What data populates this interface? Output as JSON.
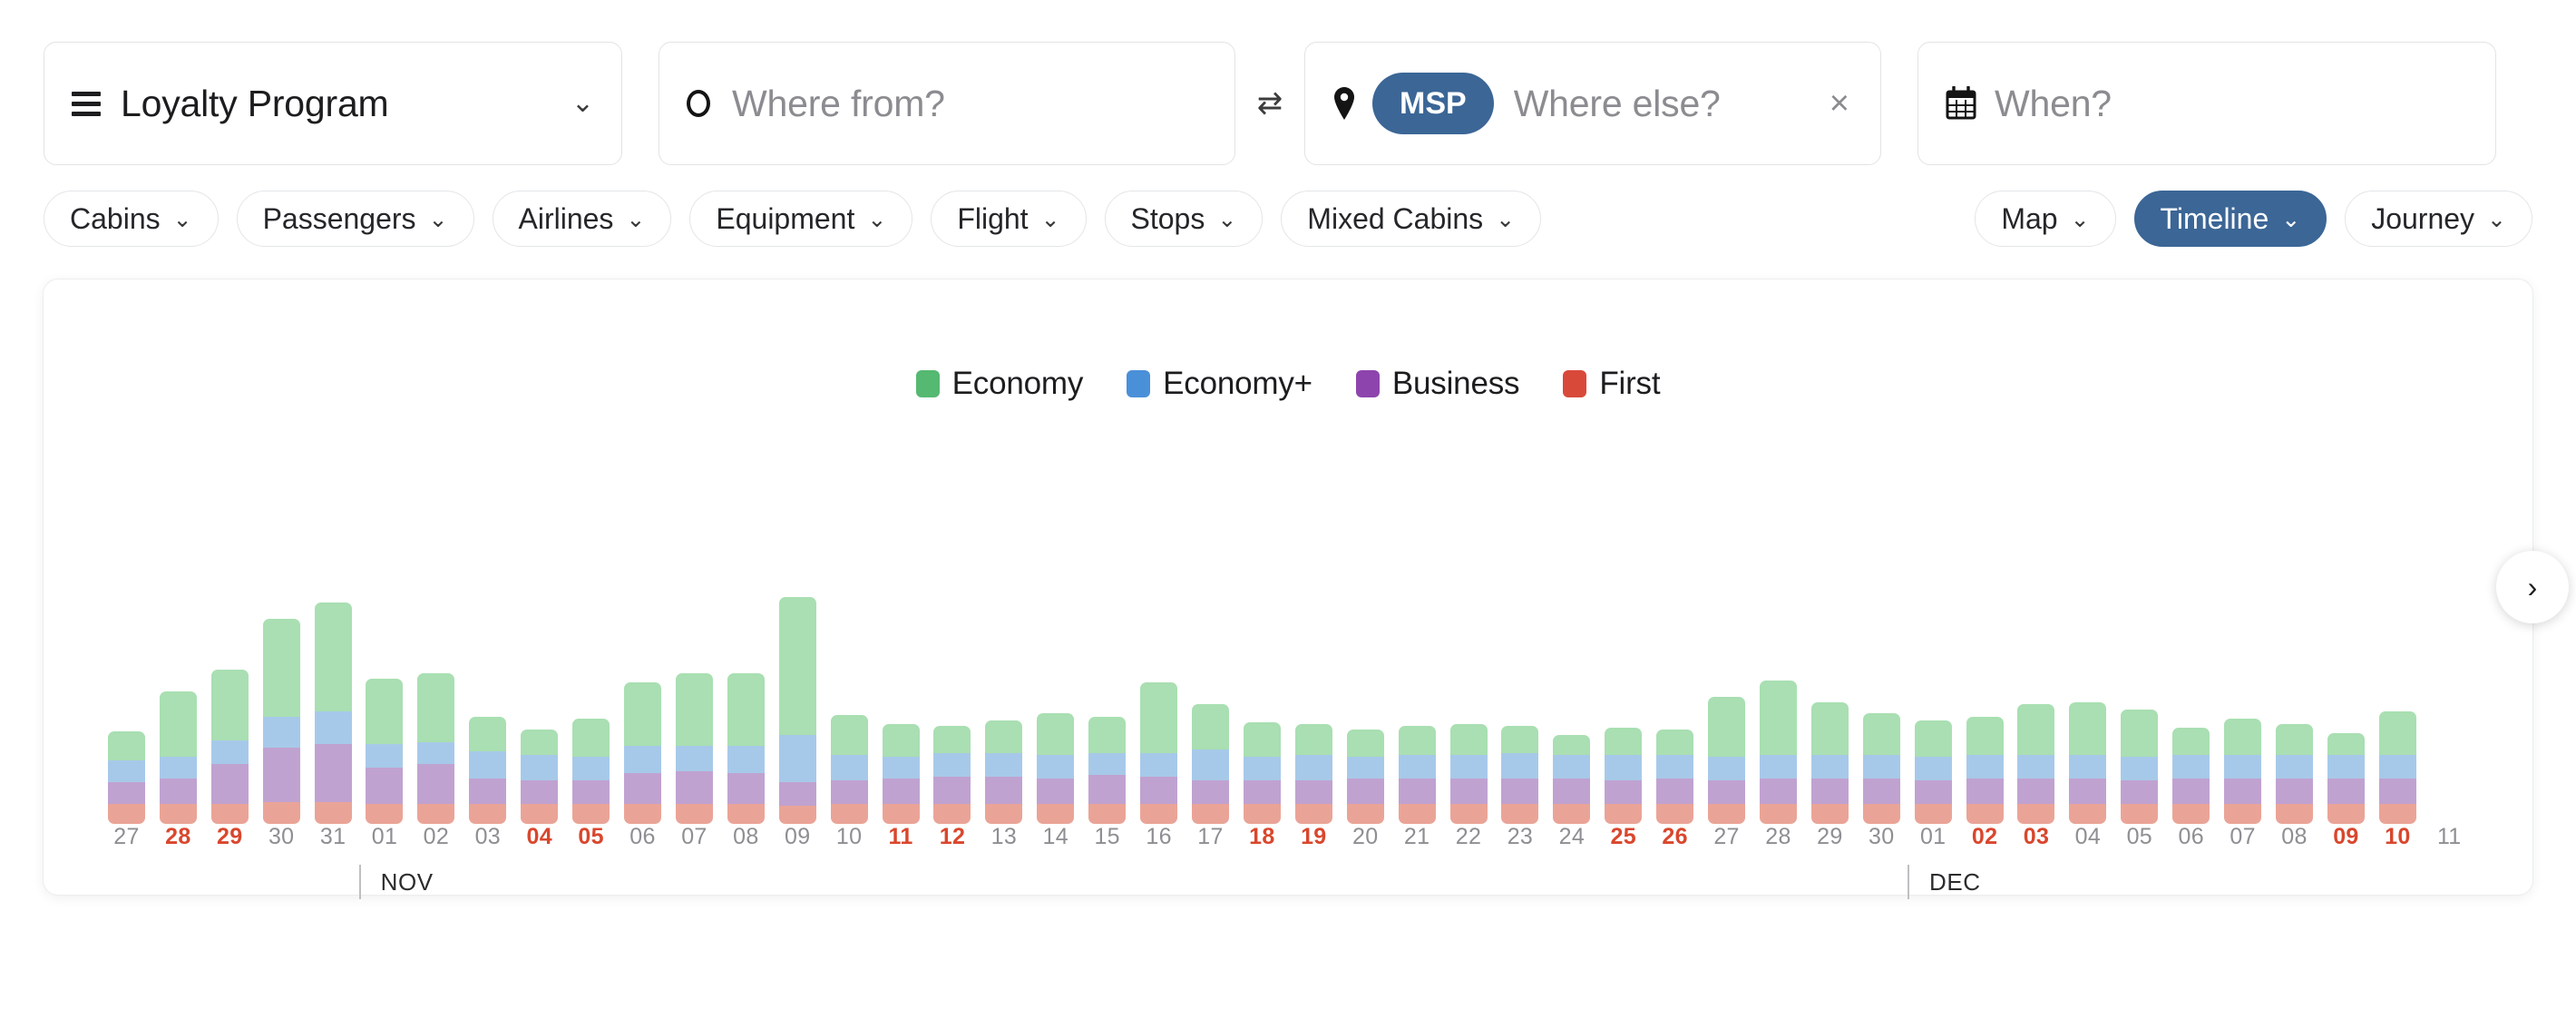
{
  "search": {
    "loyalty": {
      "label": "Loyalty Program",
      "menu_icon": "hamburger-icon",
      "chevron": "⌄"
    },
    "origin": {
      "placeholder": "Where from?",
      "icon": "circle-icon",
      "value": ""
    },
    "swap": {
      "icon": "swap-arrows-icon",
      "glyph": "⇄"
    },
    "destination": {
      "placeholder": "Where else?",
      "chip": "MSP",
      "icon": "map-pin-icon",
      "clear": "×"
    },
    "when": {
      "placeholder": "When?",
      "icon": "calendar-icon"
    }
  },
  "filters": {
    "left": [
      {
        "label": "Cabins",
        "active": false
      },
      {
        "label": "Passengers",
        "active": false
      },
      {
        "label": "Airlines",
        "active": false
      },
      {
        "label": "Equipment",
        "active": false
      },
      {
        "label": "Flight",
        "active": false
      },
      {
        "label": "Stops",
        "active": false
      },
      {
        "label": "Mixed Cabins",
        "active": false
      }
    ],
    "right": [
      {
        "label": "Map",
        "active": false
      },
      {
        "label": "Timeline",
        "active": true
      },
      {
        "label": "Journey",
        "active": false
      }
    ],
    "chevron": "⌄"
  },
  "card": {
    "next_button": "›"
  },
  "chart_data": {
    "type": "bar",
    "stacked": true,
    "title": "",
    "xlabel": "",
    "ylabel": "",
    "grid": false,
    "legend_position": "top-center",
    "colors": {
      "economy": "#a9dfb2",
      "economy_plus": "#a7c9e9",
      "business": "#c0a2d0",
      "first": "#eaa497",
      "legend_economy": "#55b971",
      "legend_economy_plus": "#4a90d9",
      "legend_business": "#8e44ad",
      "legend_first": "#d9493a",
      "weekend_label": "#d9472d",
      "weekday_label": "#8e8e93"
    },
    "legend": [
      "Economy",
      "Economy+",
      "Business",
      "First"
    ],
    "series": [
      {
        "name": "First",
        "key": "first",
        "values": [
          22,
          22,
          22,
          24,
          24,
          22,
          22,
          22,
          22,
          22,
          22,
          22,
          22,
          22,
          22,
          22,
          22,
          22,
          22,
          22,
          22,
          22,
          22,
          22,
          22,
          22,
          22,
          22,
          22,
          22,
          22,
          22,
          22,
          22,
          22,
          22,
          22,
          22,
          22,
          22,
          22,
          22,
          22,
          22,
          22
        ]
      },
      {
        "name": "Business",
        "key": "business",
        "values": [
          24,
          28,
          44,
          60,
          64,
          40,
          44,
          28,
          26,
          26,
          34,
          36,
          34,
          28,
          26,
          28,
          30,
          30,
          28,
          32,
          30,
          26,
          26,
          26,
          28,
          28,
          28,
          28,
          28,
          26,
          28,
          26,
          28,
          28,
          28,
          26,
          28,
          28,
          28,
          26,
          28,
          28,
          28,
          28,
          28
        ]
      },
      {
        "name": "Economy+",
        "key": "economyp",
        "values": [
          24,
          24,
          26,
          34,
          36,
          26,
          24,
          30,
          28,
          26,
          30,
          28,
          30,
          56,
          28,
          24,
          26,
          26,
          26,
          24,
          26,
          34,
          26,
          28,
          24,
          26,
          26,
          28,
          26,
          28,
          26,
          26,
          26,
          26,
          26,
          26,
          26,
          26,
          26,
          26,
          26,
          26,
          26,
          26,
          26
        ]
      },
      {
        "name": "Economy",
        "key": "economy",
        "values": [
          32,
          72,
          78,
          108,
          120,
          72,
          76,
          38,
          28,
          42,
          70,
          80,
          80,
          164,
          44,
          36,
          30,
          36,
          46,
          40,
          78,
          50,
          38,
          34,
          30,
          32,
          34,
          30,
          22,
          30,
          28,
          66,
          82,
          58,
          46,
          40,
          42,
          56,
          58,
          52,
          30,
          40,
          34,
          24,
          48
        ]
      }
    ],
    "days": [
      {
        "label": "27",
        "weekend": false
      },
      {
        "label": "28",
        "weekend": true
      },
      {
        "label": "29",
        "weekend": true
      },
      {
        "label": "30",
        "weekend": false
      },
      {
        "label": "31",
        "weekend": false
      },
      {
        "label": "01",
        "weekend": false
      },
      {
        "label": "02",
        "weekend": false
      },
      {
        "label": "03",
        "weekend": false
      },
      {
        "label": "04",
        "weekend": true
      },
      {
        "label": "05",
        "weekend": true
      },
      {
        "label": "06",
        "weekend": false
      },
      {
        "label": "07",
        "weekend": false
      },
      {
        "label": "08",
        "weekend": false
      },
      {
        "label": "09",
        "weekend": false
      },
      {
        "label": "10",
        "weekend": false
      },
      {
        "label": "11",
        "weekend": true
      },
      {
        "label": "12",
        "weekend": true
      },
      {
        "label": "13",
        "weekend": false
      },
      {
        "label": "14",
        "weekend": false
      },
      {
        "label": "15",
        "weekend": false
      },
      {
        "label": "16",
        "weekend": false
      },
      {
        "label": "17",
        "weekend": false
      },
      {
        "label": "18",
        "weekend": true
      },
      {
        "label": "19",
        "weekend": true
      },
      {
        "label": "20",
        "weekend": false
      },
      {
        "label": "21",
        "weekend": false
      },
      {
        "label": "22",
        "weekend": false
      },
      {
        "label": "23",
        "weekend": false
      },
      {
        "label": "24",
        "weekend": false
      },
      {
        "label": "25",
        "weekend": true
      },
      {
        "label": "26",
        "weekend": true
      },
      {
        "label": "27",
        "weekend": false
      },
      {
        "label": "28",
        "weekend": false
      },
      {
        "label": "29",
        "weekend": false
      },
      {
        "label": "30",
        "weekend": false
      },
      {
        "label": "01",
        "weekend": false
      },
      {
        "label": "02",
        "weekend": true
      },
      {
        "label": "03",
        "weekend": true
      },
      {
        "label": "04",
        "weekend": false
      },
      {
        "label": "05",
        "weekend": false
      },
      {
        "label": "06",
        "weekend": false
      },
      {
        "label": "07",
        "weekend": false
      },
      {
        "label": "08",
        "weekend": false
      },
      {
        "label": "09",
        "weekend": true
      },
      {
        "label": "10",
        "weekend": true
      },
      {
        "label": "11",
        "weekend": false
      }
    ],
    "months": [
      {
        "label": "NOV",
        "day_index": 5
      },
      {
        "label": "DEC",
        "day_index": 35
      }
    ]
  }
}
